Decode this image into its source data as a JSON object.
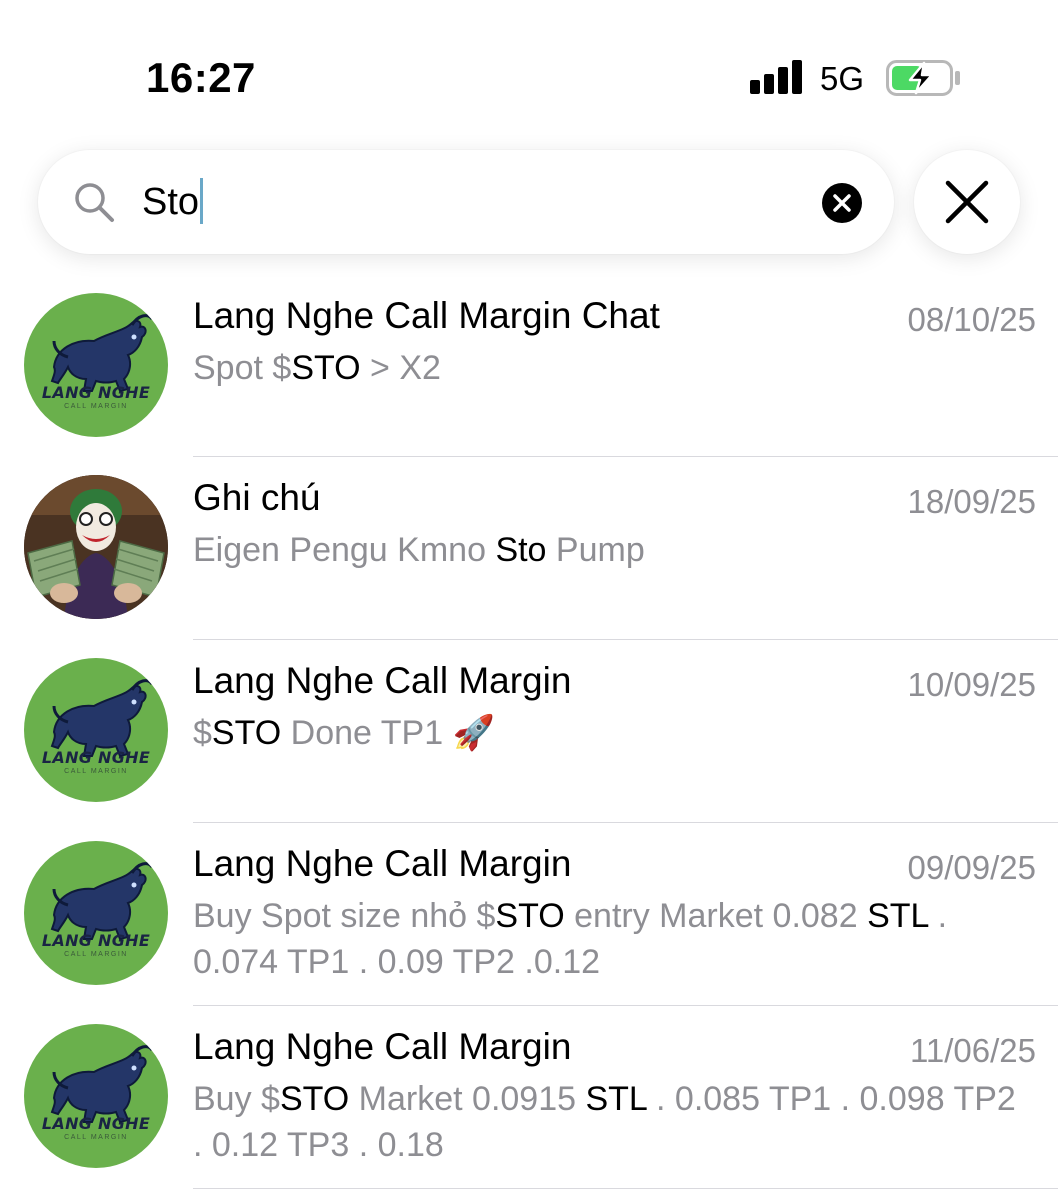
{
  "status_bar": {
    "time": "16:27",
    "network": "5G",
    "battery_color": "#4cd964"
  },
  "search": {
    "query": "Sto",
    "icons": {
      "search": "search-icon",
      "clear": "clear-circle-icon",
      "close": "close-icon"
    }
  },
  "colors": {
    "avatar_green": "#6ab04c",
    "secondary_text": "#8e8e93",
    "divider": "#d9d9de"
  },
  "results": [
    {
      "title": "Lang Nghe Call Margin Chat",
      "date": "08/10/25",
      "avatar": "lang-nghe-bull-logo",
      "avatar_text": "LANG NGHE",
      "avatar_subtext": "CALL MARGIN",
      "preview": [
        {
          "text": "Spot $",
          "hl": false
        },
        {
          "text": "STO",
          "hl": true
        },
        {
          "text": " > X2",
          "hl": false
        }
      ]
    },
    {
      "title": "Ghi chú",
      "date": "18/09/25",
      "avatar": "joker-photo",
      "preview": [
        {
          "text": "Eigen Pengu Kmno ",
          "hl": false
        },
        {
          "text": "Sto",
          "hl": true
        },
        {
          "text": " Pump",
          "hl": false
        }
      ]
    },
    {
      "title": "Lang Nghe Call Margin",
      "date": "10/09/25",
      "avatar": "lang-nghe-bull-logo",
      "avatar_text": "LANG NGHE",
      "avatar_subtext": "CALL MARGIN",
      "preview": [
        {
          "text": "$",
          "hl": false
        },
        {
          "text": "STO",
          "hl": true
        },
        {
          "text": " Done TP1 ",
          "hl": false
        },
        {
          "text": "🚀",
          "hl": false
        }
      ]
    },
    {
      "title": "Lang Nghe Call Margin",
      "date": "09/09/25",
      "avatar": "lang-nghe-bull-logo",
      "avatar_text": "LANG NGHE",
      "avatar_subtext": "CALL MARGIN",
      "preview": [
        {
          "text": "Buy Spot size nhỏ $",
          "hl": false
        },
        {
          "text": "STO",
          "hl": true
        },
        {
          "text": " entry Market 0.082 ",
          "hl": false
        },
        {
          "text": "STL",
          "hl": true
        },
        {
          "text": " . 0.074 TP1 . 0.09 TP2 .0.12",
          "hl": false
        }
      ]
    },
    {
      "title": "Lang Nghe Call Margin",
      "date": "11/06/25",
      "avatar": "lang-nghe-bull-logo",
      "avatar_text": "LANG NGHE",
      "avatar_subtext": "CALL MARGIN",
      "preview": [
        {
          "text": "Buy $",
          "hl": false
        },
        {
          "text": "STO",
          "hl": true
        },
        {
          "text": " Market 0.0915 ",
          "hl": false
        },
        {
          "text": "STL",
          "hl": true
        },
        {
          "text": " . 0.085 TP1 . 0.098 TP2 . 0.12 TP3 . 0.18",
          "hl": false
        }
      ]
    }
  ]
}
